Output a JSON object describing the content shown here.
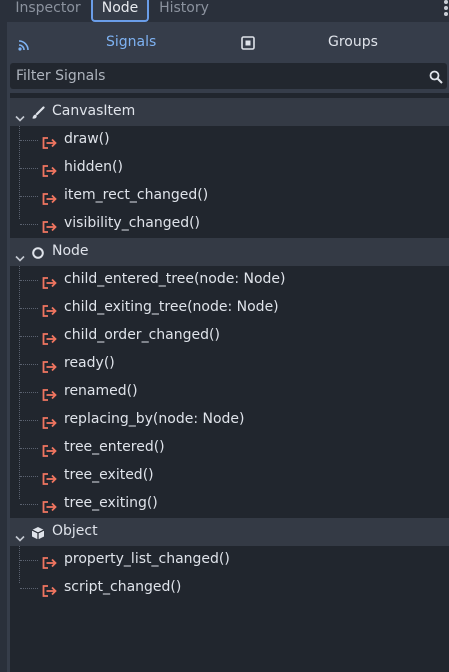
{
  "tabs": {
    "inspector": "Inspector",
    "node": "Node",
    "history": "History"
  },
  "modes": {
    "signals": "Signals",
    "groups": "Groups"
  },
  "filter": {
    "placeholder": "Filter Signals",
    "value": ""
  },
  "colors": {
    "accent": "#7eb2f2",
    "signal_icon": "#f07560",
    "tab_border": "#6a9de8"
  },
  "tree": {
    "categories": [
      {
        "label": "CanvasItem",
        "icon": "brush-icon",
        "signals": [
          "draw()",
          "hidden()",
          "item_rect_changed()",
          "visibility_changed()"
        ]
      },
      {
        "label": "Node",
        "icon": "circle-node-icon",
        "signals": [
          "child_entered_tree(node: Node)",
          "child_exiting_tree(node: Node)",
          "child_order_changed()",
          "ready()",
          "renamed()",
          "replacing_by(node: Node)",
          "tree_entered()",
          "tree_exited()",
          "tree_exiting()"
        ]
      },
      {
        "label": "Object",
        "icon": "cube-icon",
        "signals": [
          "property_list_changed()",
          "script_changed()"
        ]
      }
    ]
  }
}
